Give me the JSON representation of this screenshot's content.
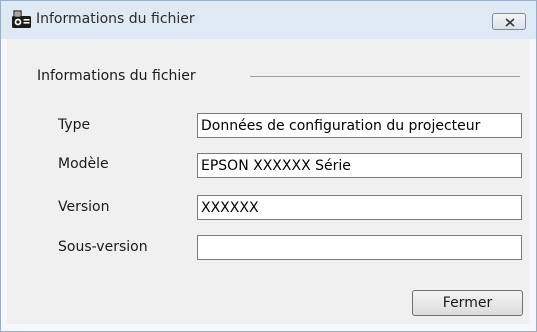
{
  "window": {
    "title": "Informations du fichier",
    "app_icon": "projector-file-icon",
    "close_icon": "close-icon"
  },
  "group": {
    "label": "Informations du fichier"
  },
  "fields": [
    {
      "label": "Type",
      "value": "Données de configuration du projecteur"
    },
    {
      "label": "Modèle",
      "value": "EPSON XXXXXX Série"
    },
    {
      "label": "Version",
      "value": "XXXXXX"
    },
    {
      "label": "Sous-version",
      "value": ""
    }
  ],
  "buttons": {
    "close_label": "Fermer"
  },
  "colors": {
    "titlebar": "#dfe9f4",
    "dialog_body": "#f0f0f0",
    "border": "#9aaec6"
  }
}
